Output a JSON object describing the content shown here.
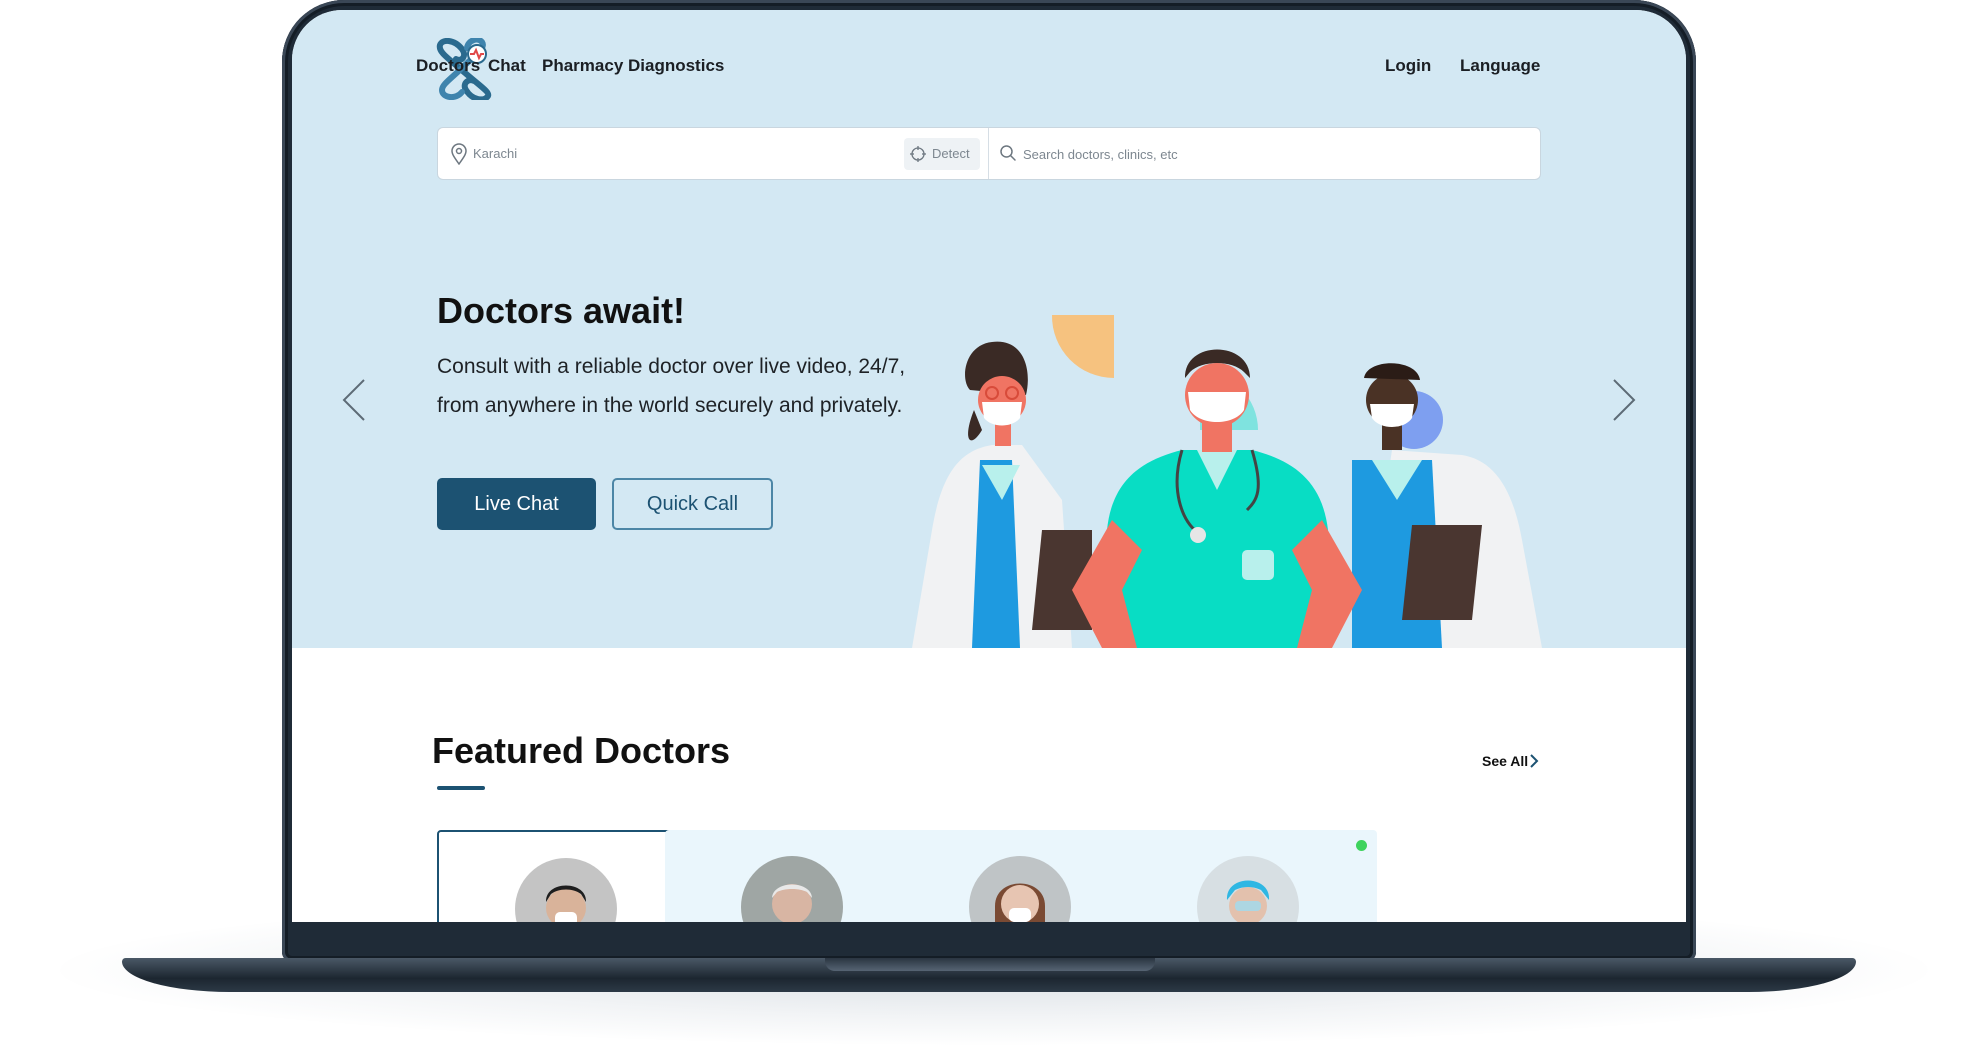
{
  "nav": {
    "left": [
      "Doctors",
      "Chat",
      "Pharmacy",
      "Diagnostics"
    ],
    "right": [
      "Login",
      "Language"
    ]
  },
  "search": {
    "location_value": "Karachi",
    "detect_label": "Detect",
    "placeholder": "Search doctors, clinics, etc"
  },
  "hero": {
    "title": "Doctors await!",
    "description": "Consult with a reliable doctor over live video, 24/7, from anywhere in the world securely and privately.",
    "primary_button": "Live Chat",
    "secondary_button": "Quick Call"
  },
  "featured": {
    "title": "Featured Doctors",
    "see_all": "See All",
    "doctors": [
      {
        "online": true
      },
      {
        "online": false
      },
      {
        "online": true
      },
      {
        "online": true
      }
    ]
  },
  "colors": {
    "hero_bg": "#d3e8f3",
    "brand": "#1c5272",
    "online": "#3ed35d",
    "offline": "#d2d6da",
    "card_bg": "#eaf6fc"
  },
  "icons": [
    "logo",
    "location-pin-icon",
    "crosshair-icon",
    "search-icon",
    "chevron-left-icon",
    "chevron-right-icon"
  ]
}
